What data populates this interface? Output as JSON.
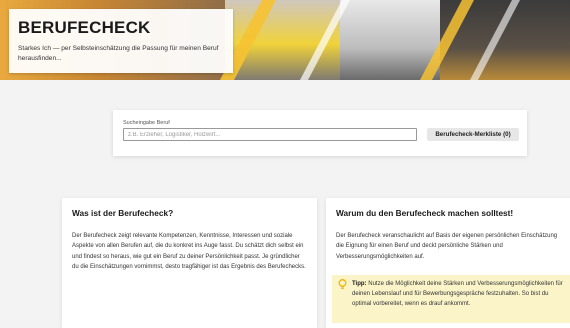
{
  "hero": {
    "title": "BERUFECHECK",
    "subtitle": "Starkes Ich — per Selbsteinschätzung die Passung für meinen Beruf herausfinden..."
  },
  "search": {
    "label": "Sucheingabe Beruf",
    "value": "",
    "placeholder": "z.B. Erzieher, Logistiker, Holzwirt...",
    "merkliste_button": "Berufecheck-Merkliste (0)"
  },
  "info_left": {
    "title": "Was ist der Berufecheck?",
    "body": "Der Berufecheck zeigt relevante Kompetenzen, Kenntnisse, Interessen und soziale Aspekte von allen Berufen auf, die du konkret ins Auge fasst. Du schätzt dich selbst ein und findest so heraus, wie gut ein Beruf zu deiner Persönlichkeit passt. Je gründlicher du die Einschätzungen vornimmst, desto tragfähiger ist das Ergebnis des Berufechecks."
  },
  "info_right": {
    "title": "Warum du den Berufecheck machen solltest!",
    "body": "Der Berufecheck veranschaulicht auf Basis der eigenen persönlichen Einschätzung die Eignung für einen Beruf und deckt persönliche Stärken und Verbesserungsmöglichkeiten auf.",
    "tip_label": "Tipp:",
    "tip_text": " Nutze die Möglichkeit deine Stärken und Verbesserungsmöglichkeiten für deinen Lebenslauf und für Bewerbungsgespräche festzuhalten. So bist du optimal vorbereitet, wenn es drauf ankommt."
  },
  "icons": {
    "tip": "lightbulb-icon"
  },
  "colors": {
    "tip_background": "#fbf4c9",
    "tip_icon": "#f0b400",
    "accent_stripes": "#f6c233"
  }
}
